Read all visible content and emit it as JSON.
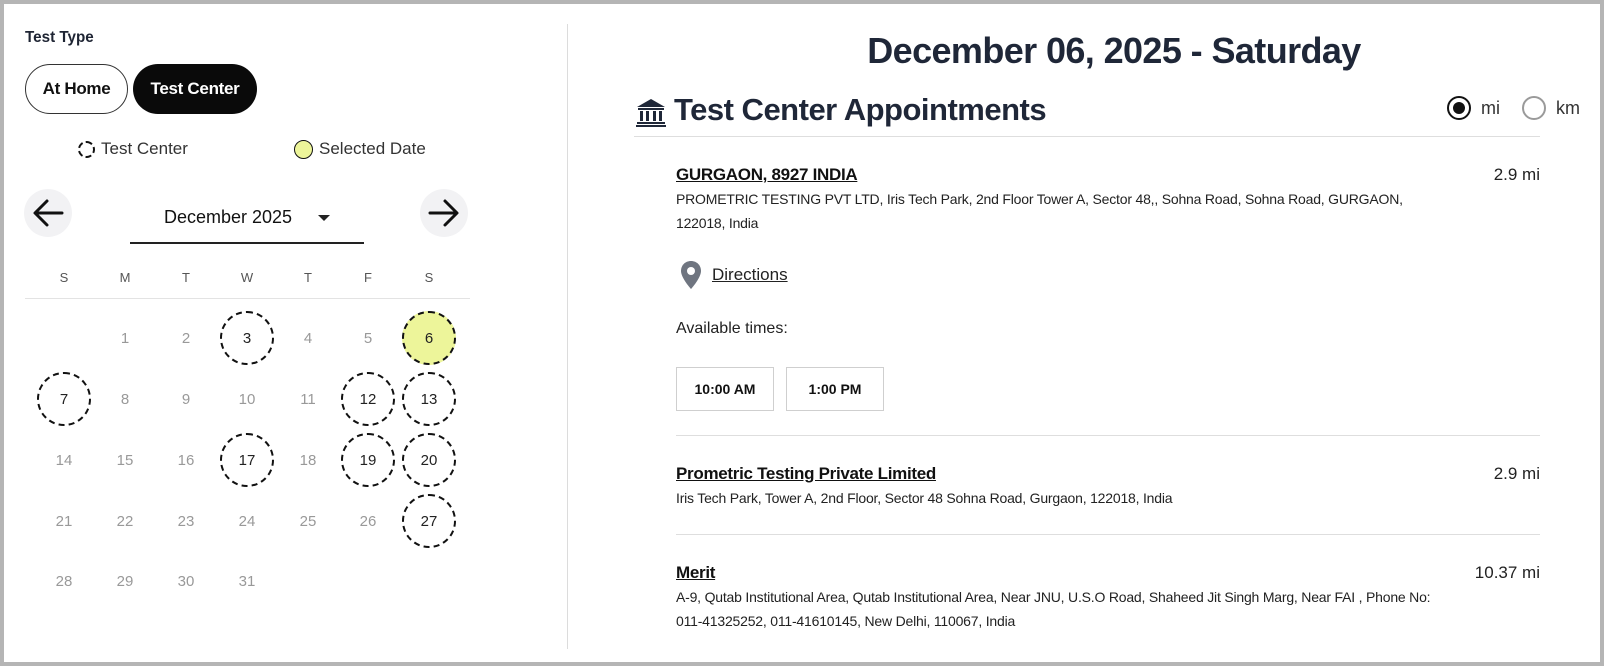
{
  "test_type": {
    "label": "Test Type",
    "options": [
      "At Home",
      "Test Center"
    ],
    "selected": "Test Center"
  },
  "legend": {
    "test_center": "Test Center",
    "selected_date": "Selected Date"
  },
  "calendar": {
    "month_label": "December 2025",
    "weekdays": [
      "S",
      "M",
      "T",
      "W",
      "T",
      "F",
      "S"
    ],
    "weeks": [
      [
        null,
        1,
        2,
        3,
        4,
        5,
        6
      ],
      [
        7,
        8,
        9,
        10,
        11,
        12,
        13
      ],
      [
        14,
        15,
        16,
        17,
        18,
        19,
        20
      ],
      [
        21,
        22,
        23,
        24,
        25,
        26,
        27
      ],
      [
        28,
        29,
        30,
        31,
        null,
        null,
        null
      ]
    ],
    "available_days": [
      3,
      6,
      7,
      12,
      13,
      17,
      19,
      20,
      27
    ],
    "selected_day": 6,
    "selected_color": "#edf59a"
  },
  "main": {
    "date_heading": "December 06, 2025 - Saturday",
    "section_title": "Test Center Appointments",
    "section_icon": "bank-icon",
    "units": {
      "options": [
        "mi",
        "km"
      ],
      "selected": "mi"
    },
    "centers": [
      {
        "name": "GURGAON, 8927 INDIA",
        "address": "PROMETRIC TESTING PVT LTD, Iris Tech Park, 2nd Floor Tower A, Sector 48,, Sohna Road, Sohna Road, GURGAON, 122018, India",
        "distance": "2.9 mi",
        "directions_label": "Directions",
        "available_label": "Available times:",
        "times": [
          "10:00 AM",
          "1:00 PM"
        ]
      },
      {
        "name": "Prometric Testing Private Limited",
        "address": "Iris Tech Park, Tower A, 2nd Floor, Sector 48 Sohna Road, Gurgaon, 122018, India",
        "distance": "2.9 mi"
      },
      {
        "name": "Merit",
        "address": "A-9, Qutab Institutional Area, Qutab Institutional Area, Near JNU, U.S.O Road, Shaheed Jit Singh Marg, Near FAI , Phone No: 011-41325252, 011-41610145, New Delhi, 110067, India",
        "distance": "10.37 mi"
      }
    ]
  }
}
